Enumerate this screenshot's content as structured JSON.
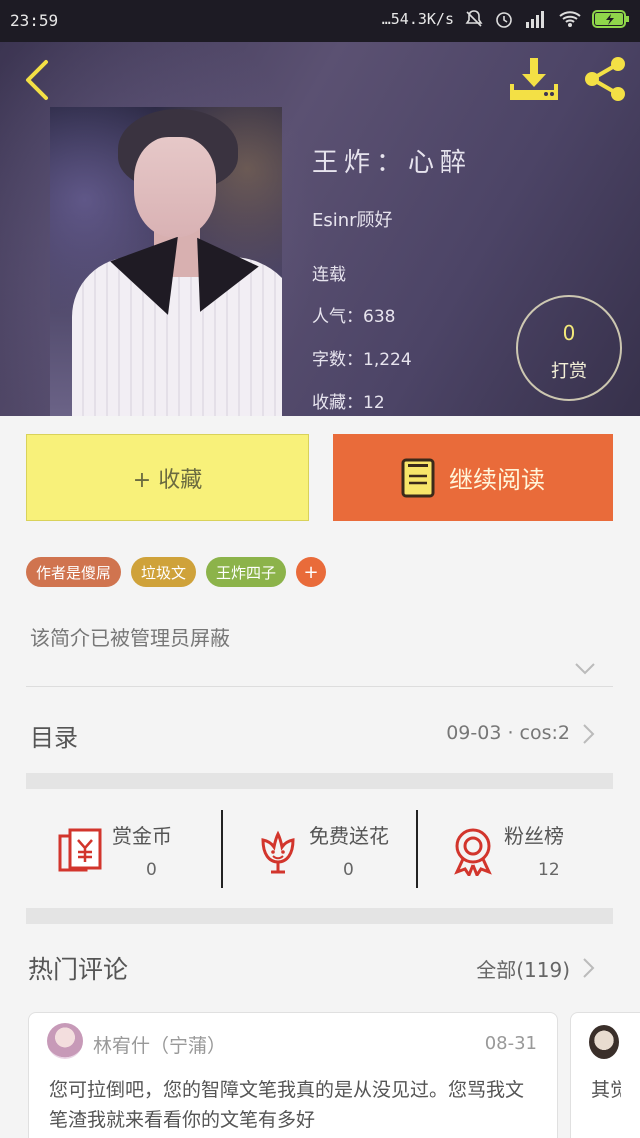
{
  "status_bar": {
    "time": "23:59",
    "network_speed": "…54.3K/s"
  },
  "book": {
    "title": "王炸：心醉",
    "author": "Esinr顾好",
    "status": "连载",
    "popularity": "人气：638",
    "word_count": "字数：1,224",
    "favorites": "收藏：12"
  },
  "tip": {
    "count": "0",
    "label": "打赏"
  },
  "actions": {
    "favorite_label": "+ 收藏",
    "continue_label": "继续阅读"
  },
  "tags": [
    {
      "label": "作者是傻屌",
      "color": "#d0744f"
    },
    {
      "label": "垃圾文",
      "color": "#cfa23a"
    },
    {
      "label": "王炸四子",
      "color": "#8cb34a"
    }
  ],
  "tag_add_label": "+",
  "intro": "该简介已被管理员屏蔽",
  "toc": {
    "label": "目录",
    "meta": "09-03 · cos:2"
  },
  "stats": [
    {
      "name": "赏金币",
      "value": "0",
      "icon": "red-envelope-icon"
    },
    {
      "name": "免费送花",
      "value": "0",
      "icon": "flower-icon"
    },
    {
      "name": "粉丝榜",
      "value": "12",
      "icon": "medal-icon"
    }
  ],
  "hot_comments": {
    "title": "热门评论",
    "all_label": "全部(119)"
  },
  "comments": [
    {
      "user": "林宥什（宁蒲）",
      "date": "08-31",
      "text": "您可拉倒吧，您的智障文笔我真的是从没见过。您骂我文笔渣我就来看看你的文笔有多好"
    },
    {
      "text": "其觉"
    }
  ],
  "colors": {
    "accent_yellow": "#f3e045",
    "accent_orange": "#e96b3a",
    "icon_red": "#d2352c"
  }
}
